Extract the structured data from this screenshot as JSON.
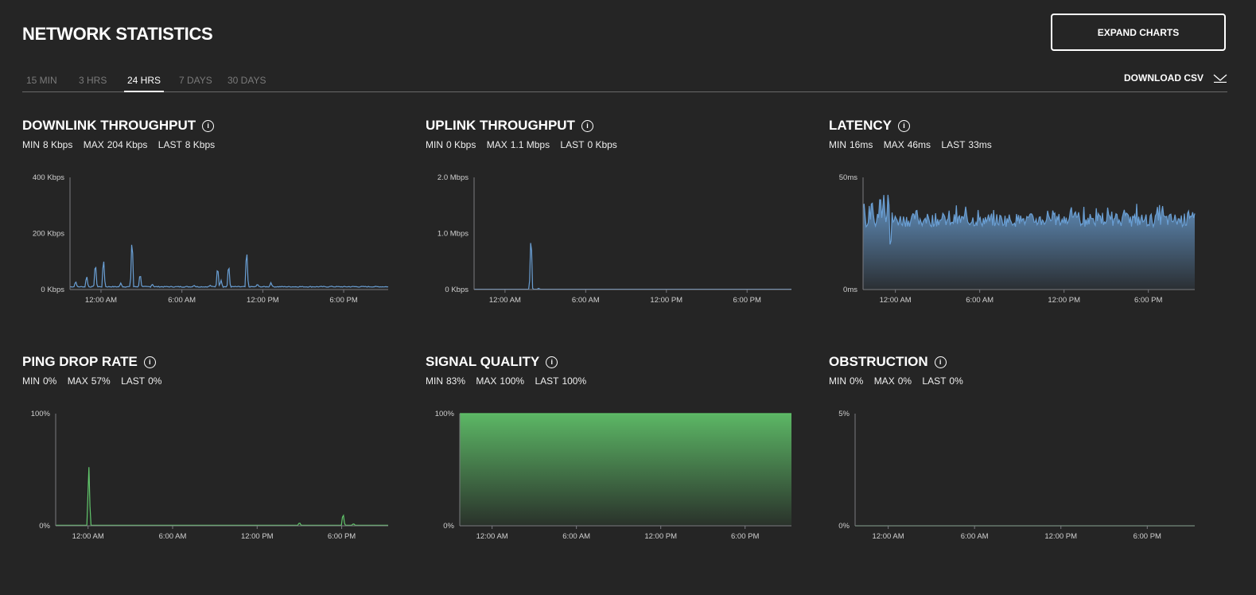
{
  "header": {
    "title": "NETWORK STATISTICS",
    "expand_label": "EXPAND CHARTS",
    "download_label": "DOWNLOAD CSV"
  },
  "tabs": [
    {
      "label": "15 MIN",
      "active": false
    },
    {
      "label": "3 HRS",
      "active": false
    },
    {
      "label": "24 HRS",
      "active": true
    },
    {
      "label": "7 DAYS",
      "active": false
    },
    {
      "label": "30 DAYS",
      "active": false
    }
  ],
  "colors": {
    "background": "#252525",
    "blue": "#6a9fd4",
    "green": "#62c76c",
    "axis": "#7a7a80"
  },
  "panels": [
    {
      "title": "DOWNLINK THROUGHPUT",
      "stats": {
        "min_label": "MIN",
        "min": "8 Kbps",
        "max_label": "MAX",
        "max": "204 Kbps",
        "last_label": "LAST",
        "last": "8 Kbps"
      }
    },
    {
      "title": "UPLINK THROUGHPUT",
      "stats": {
        "min_label": "MIN",
        "min": "0 Kbps",
        "max_label": "MAX",
        "max": "1.1 Mbps",
        "last_label": "LAST",
        "last": "0 Kbps"
      }
    },
    {
      "title": "LATENCY",
      "stats": {
        "min_label": "MIN",
        "min": "16ms",
        "max_label": "MAX",
        "max": "46ms",
        "last_label": "LAST",
        "last": "33ms"
      }
    },
    {
      "title": "PING DROP RATE",
      "stats": {
        "min_label": "MIN",
        "min": "0%",
        "max_label": "MAX",
        "max": "57%",
        "last_label": "LAST",
        "last": "0%"
      }
    },
    {
      "title": "SIGNAL QUALITY",
      "stats": {
        "min_label": "MIN",
        "min": "83%",
        "max_label": "MAX",
        "max": "100%",
        "last_label": "LAST",
        "last": "100%"
      }
    },
    {
      "title": "OBSTRUCTION",
      "stats": {
        "min_label": "MIN",
        "min": "0%",
        "max_label": "MAX",
        "max": "0%",
        "last_label": "LAST",
        "last": "0%"
      }
    }
  ],
  "chart_data": [
    {
      "type": "line",
      "unit": "Kbps",
      "x_range": [
        "21:42",
        "21:18"
      ],
      "x_ticks": [
        "12:00 AM",
        "6:00 AM",
        "12:00 PM",
        "6:00 PM"
      ],
      "y_ticks": [
        "0 Kbps",
        "200 Kbps",
        "400 Kbps"
      ],
      "ylim": [
        0,
        400
      ],
      "color": "blue",
      "fill": false,
      "baseline": 10,
      "peaks": [
        [
          "22:07",
          31
        ],
        [
          "22:56",
          52
        ],
        [
          "23:35",
          105
        ],
        [
          "00:11",
          122
        ],
        [
          "01:28",
          24
        ],
        [
          "02:18",
          204
        ],
        [
          "02:54",
          62
        ],
        [
          "03:48",
          20
        ],
        [
          "06:54",
          15
        ],
        [
          "08:06",
          15
        ],
        [
          "08:39",
          90
        ],
        [
          "08:54",
          35
        ],
        [
          "09:28",
          100
        ],
        [
          "10:48",
          159
        ],
        [
          "11:36",
          20
        ],
        [
          "12:36",
          25
        ],
        [
          "17:06",
          12
        ]
      ]
    },
    {
      "type": "line",
      "unit": "Mbps",
      "x_range": [
        "21:42",
        "21:18"
      ],
      "x_ticks": [
        "12:00 AM",
        "6:00 AM",
        "12:00 PM",
        "6:00 PM"
      ],
      "y_ticks": [
        "0 Kbps",
        "1.0 Mbps",
        "2.0 Mbps"
      ],
      "ylim": [
        0,
        2.0
      ],
      "color": "blue",
      "fill": false,
      "baseline": 0.005,
      "peaks": [
        [
          "01:56",
          1.1
        ],
        [
          "02:30",
          0.02
        ]
      ]
    },
    {
      "type": "area",
      "unit": "ms",
      "x_range": [
        "21:42",
        "21:18"
      ],
      "x_ticks": [
        "12:00 AM",
        "6:00 AM",
        "12:00 PM",
        "6:00 PM"
      ],
      "y_ticks": [
        "0ms",
        "50ms"
      ],
      "ylim": [
        0,
        50
      ],
      "color": "blue",
      "fill": true,
      "baseline": 31,
      "peaks": [
        [
          "21:45",
          40
        ],
        [
          "22:20",
          41
        ],
        [
          "22:55",
          44
        ],
        [
          "23:10",
          43
        ],
        [
          "23:30",
          46
        ],
        [
          "23:39",
          16
        ],
        [
          "01:30",
          37
        ],
        [
          "05:00",
          37
        ],
        [
          "12:30",
          38
        ],
        [
          "19:00",
          38
        ],
        [
          "20:50",
          36
        ]
      ]
    },
    {
      "type": "line",
      "unit": "%",
      "x_range": [
        "21:42",
        "21:18"
      ],
      "x_ticks": [
        "12:00 AM",
        "6:00 AM",
        "12:00 PM",
        "6:00 PM"
      ],
      "y_ticks": [
        "0%",
        "100%"
      ],
      "ylim": [
        0,
        100
      ],
      "color": "green",
      "fill": false,
      "baseline": 0.5,
      "peaks": [
        [
          "00:03",
          57
        ],
        [
          "15:00",
          3
        ],
        [
          "18:06",
          12
        ],
        [
          "18:50",
          2
        ]
      ]
    },
    {
      "type": "area",
      "unit": "%",
      "x_range": [
        "21:42",
        "21:18"
      ],
      "x_ticks": [
        "12:00 AM",
        "6:00 AM",
        "12:00 PM",
        "6:00 PM"
      ],
      "y_ticks": [
        "0%",
        "100%"
      ],
      "ylim": [
        0,
        100
      ],
      "color": "green",
      "fill": true,
      "baseline": 100,
      "peaks": [
        [
          "23:57",
          83
        ]
      ]
    },
    {
      "type": "line",
      "unit": "%",
      "x_range": [
        "21:42",
        "21:18"
      ],
      "x_ticks": [
        "12:00 AM",
        "6:00 AM",
        "12:00 PM",
        "6:00 PM"
      ],
      "y_ticks": [
        "0%",
        "5%"
      ],
      "ylim": [
        0,
        5
      ],
      "color": "green",
      "fill": false,
      "baseline": 0,
      "peaks": []
    }
  ]
}
